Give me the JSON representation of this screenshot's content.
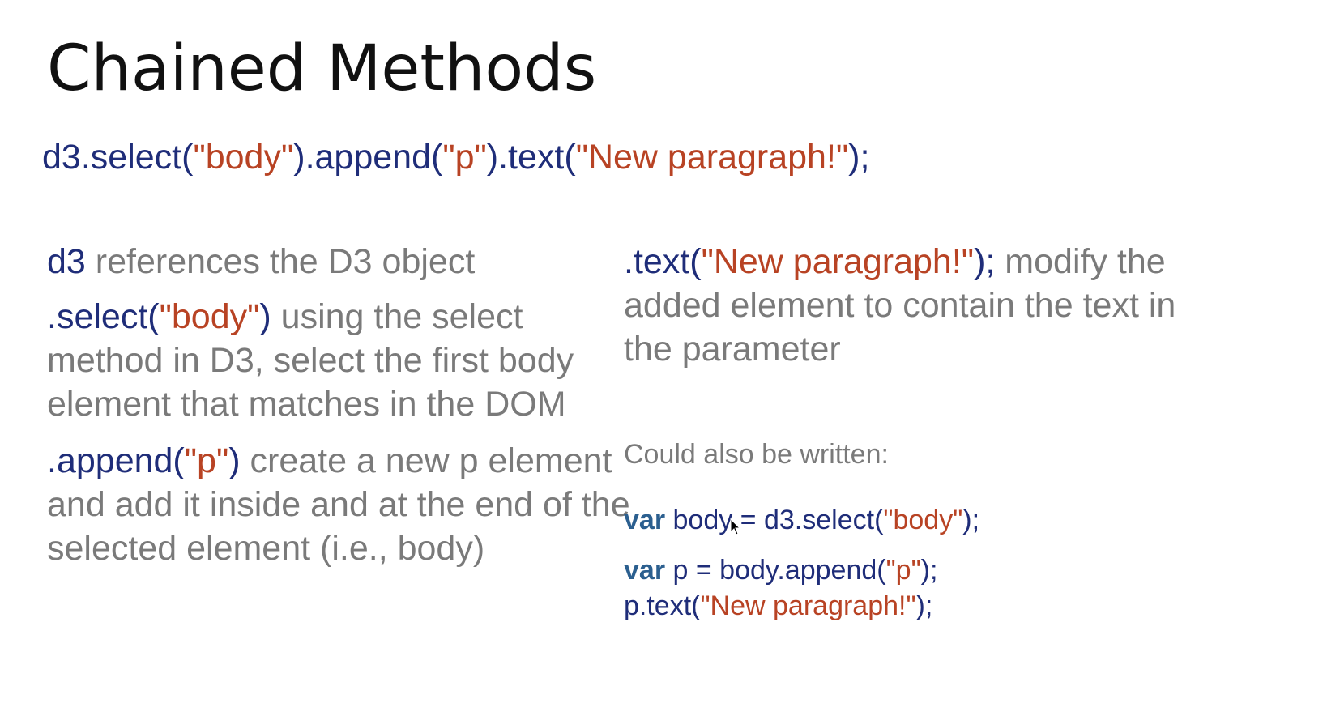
{
  "title": "Chained Methods",
  "main_code": {
    "obj": "d3",
    "select_call": ".select(",
    "select_arg": "\"body\"",
    "close1": ")",
    "append_call": ".append(",
    "append_arg": "\"p\"",
    "close2": ")",
    "text_call": ".text(",
    "text_arg": "\"New paragraph!\"",
    "close3": ");"
  },
  "explanations": {
    "d3": {
      "code": "d3",
      "desc": " references the D3 object"
    },
    "select": {
      "code_fn": ".select(",
      "code_arg": "\"body\"",
      "code_close": ")",
      "desc": " using the select method in D3, select the first body element that matches in the DOM"
    },
    "append": {
      "code_fn": ".append(",
      "code_arg": "\"p\"",
      "code_close": ")",
      "desc": " create a new p element and add it inside and at the end of the selected element (i.e., body)"
    },
    "text": {
      "code_fn": ".text(",
      "code_arg": "\"New paragraph!\"",
      "code_close": ");",
      "desc": " modify the added element to contain the text in the parameter"
    }
  },
  "alternative": {
    "heading": "Could also be written:",
    "line1": {
      "kw": "var",
      "rest": " body = d3.select(",
      "arg": "\"body\"",
      "close": ");"
    },
    "line2": {
      "kw": "var",
      "rest": " p = body.append(",
      "arg": "\"p\"",
      "close": ");"
    },
    "line3": {
      "pre": "p.text(",
      "arg": "\"New paragraph!\"",
      "close": ");"
    }
  }
}
